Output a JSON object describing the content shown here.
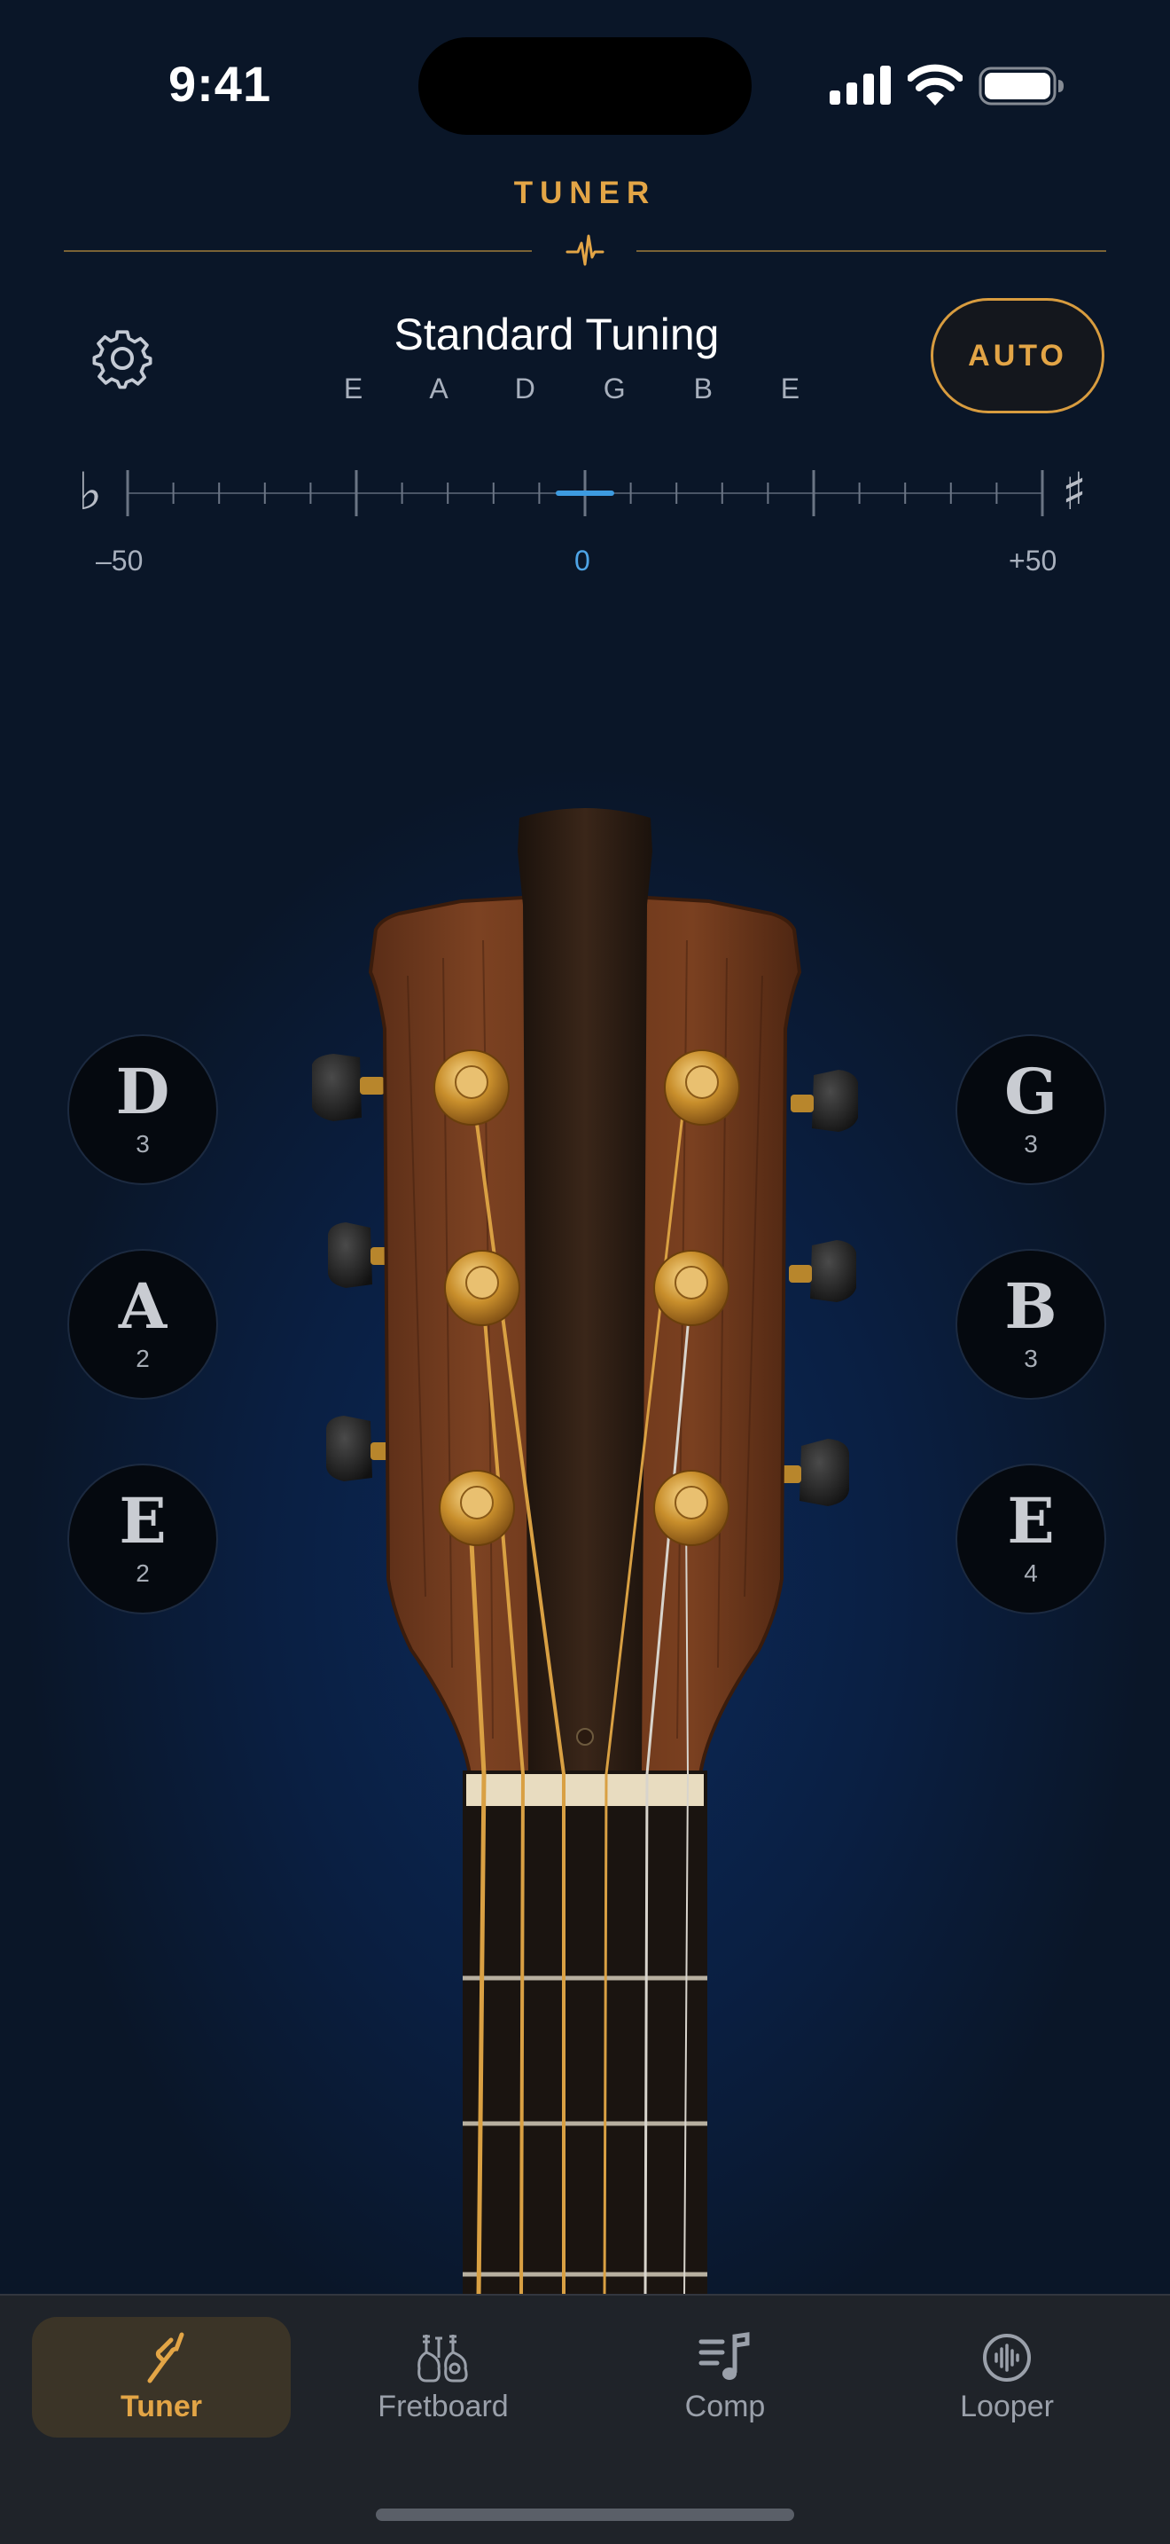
{
  "status": {
    "time": "9:41"
  },
  "header": {
    "title": "TUNER"
  },
  "tuning": {
    "name": "Standard Tuning",
    "notes": "E A D G B E",
    "auto_label": "AUTO"
  },
  "meter": {
    "flat_symbol": "♭",
    "sharp_symbol": "♯",
    "min_label": "–50",
    "zero_label": "0",
    "max_label": "+50",
    "current_cents": 0
  },
  "strings": [
    {
      "note": "D",
      "octave": "3"
    },
    {
      "note": "A",
      "octave": "2"
    },
    {
      "note": "E",
      "octave": "2"
    },
    {
      "note": "G",
      "octave": "3"
    },
    {
      "note": "B",
      "octave": "3"
    },
    {
      "note": "E",
      "octave": "4"
    }
  ],
  "tabs": [
    {
      "label": "Tuner",
      "icon": "tuning-fork-icon",
      "active": true
    },
    {
      "label": "Fretboard",
      "icon": "guitars-icon",
      "active": false
    },
    {
      "label": "Comp",
      "icon": "music-list-icon",
      "active": false
    },
    {
      "label": "Looper",
      "icon": "waveform-circle-icon",
      "active": false
    }
  ],
  "colors": {
    "accent": "#e3a546",
    "meter_center": "#4ea4e6",
    "background": "#0a1a36"
  }
}
